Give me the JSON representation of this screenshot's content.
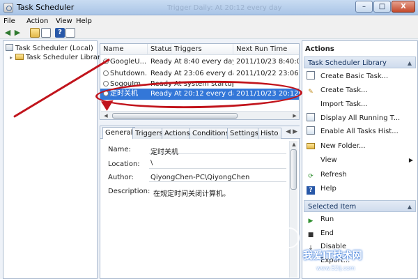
{
  "window": {
    "title": "Task Scheduler",
    "behind_text": "Trigger    Daily: At 20:12 every day",
    "minimize": "–",
    "maximize": "□",
    "close": "X"
  },
  "menu": [
    "File",
    "Action",
    "View",
    "Help"
  ],
  "toolbar": {
    "back_icon": "back-arrow-icon",
    "forward_icon": "forward-arrow-icon",
    "back_glyph": "◀",
    "forward_glyph": "▶",
    "help_glyph": "?"
  },
  "tree": {
    "root": "Task Scheduler (Local)",
    "library": "Task Scheduler Library",
    "expander": "▸"
  },
  "task_list": {
    "headers": [
      "Name",
      "Status",
      "Triggers",
      "Next Run Time"
    ],
    "rows": [
      {
        "name": "GoogleU...",
        "status": "Ready",
        "trigger": "At 8:40 every day",
        "next": "2011/10/23 8:40:00"
      },
      {
        "name": "Shutdown...",
        "status": "Ready",
        "trigger": "At 23:06 every day",
        "next": "2011/10/22 23:06:22"
      },
      {
        "name": "SogouIm...",
        "status": "Ready",
        "trigger": "At system startup",
        "next": ""
      },
      {
        "name": "定时关机",
        "status": "Ready",
        "trigger": "At 20:12 every day",
        "next": "2011/10/23 20:12:46"
      }
    ],
    "scroll_left": "◀",
    "scroll_right": "▶"
  },
  "details": {
    "tabs": [
      "General",
      "Triggers",
      "Actions",
      "Conditions",
      "Settings",
      "Histo"
    ],
    "tab_arrows": "◀ ▶",
    "fields": {
      "name_label": "Name:",
      "name_value": "定时关机",
      "location_label": "Location:",
      "location_value": "\\",
      "author_label": "Author:",
      "author_value": "QiyongChen-PC\\QiyongChen",
      "description_label": "Description:",
      "description_value": "在规定时间关闭计算机。"
    },
    "scroll_up": "▲"
  },
  "actions": {
    "title": "Actions",
    "library_section": "Task Scheduler Library",
    "library_items": [
      {
        "label": "Create Basic Task...",
        "icon": "create-basic-task-icon"
      },
      {
        "label": "Create Task...",
        "icon": "create-task-icon"
      },
      {
        "label": "Import Task...",
        "icon": "import-task-icon"
      },
      {
        "label": "Display All Running T...",
        "icon": "running-tasks-icon"
      },
      {
        "label": "Enable All Tasks Hist...",
        "icon": "history-icon"
      },
      {
        "label": "New Folder...",
        "icon": "folder-icon"
      },
      {
        "label": "View",
        "icon": "view-icon"
      },
      {
        "label": "Refresh",
        "icon": "refresh-icon"
      },
      {
        "label": "Help",
        "icon": "help-icon"
      }
    ],
    "selected_section": "Selected Item",
    "selected_items": [
      {
        "label": "Run",
        "icon": "run-icon"
      },
      {
        "label": "End",
        "icon": "end-icon"
      },
      {
        "label": "Disable",
        "icon": "disable-icon"
      },
      {
        "label": "Export...",
        "icon": "export-icon"
      }
    ],
    "section_caret": "▲",
    "submenu_caret": "▶"
  },
  "watermark": {
    "text": "我爱IT技术网",
    "url": "www.52ij.com"
  },
  "colors": {
    "selection": "#3377d8",
    "annotation": "#c1141c",
    "window_chrome": "#b9d1ea"
  }
}
